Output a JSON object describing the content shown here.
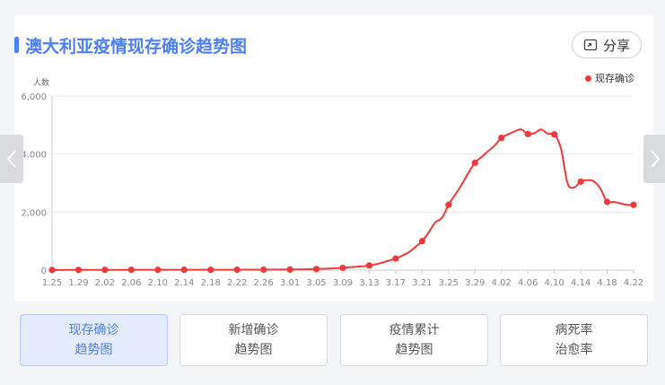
{
  "header": {
    "title": "澳大利亚疫情现存确诊趋势图",
    "share_label": "分享"
  },
  "colors": {
    "accent": "#4d7ff5",
    "series": "#f03a3a",
    "grid": "#ececec",
    "axis_text": "#888888"
  },
  "tabs": [
    {
      "line1": "现存确诊",
      "line2": "趋势图",
      "active": true
    },
    {
      "line1": "新增确诊",
      "line2": "趋势图",
      "active": false
    },
    {
      "line1": "疫情累计",
      "line2": "趋势图",
      "active": false
    },
    {
      "line1": "病死率",
      "line2": "治愈率",
      "active": false
    }
  ],
  "chart_data": {
    "type": "line",
    "title": "澳大利亚疫情现存确诊趋势图",
    "ylabel": "人数",
    "ylim": [
      0,
      6000
    ],
    "yticks": [
      0,
      2000,
      4000,
      6000
    ],
    "ytick_labels": [
      "0",
      "2,000",
      "4,000",
      "6,000"
    ],
    "xtick_labels": [
      "1.25",
      "1.29",
      "2.02",
      "2.06",
      "2.10",
      "2.14",
      "2.18",
      "2.22",
      "2.26",
      "3.01",
      "3.05",
      "3.09",
      "3.13",
      "3.17",
      "3.21",
      "3.25",
      "3.29",
      "4.02",
      "4.06",
      "4.10",
      "4.14",
      "4.18",
      "4.22"
    ],
    "legend_position": "top-right",
    "grid": true,
    "series": [
      {
        "name": "现存确诊",
        "color": "#f03a3a",
        "dates": [
          "1.25",
          "1.26",
          "1.27",
          "1.28",
          "1.29",
          "1.30",
          "1.31",
          "2.01",
          "2.02",
          "2.03",
          "2.04",
          "2.05",
          "2.06",
          "2.07",
          "2.08",
          "2.09",
          "2.10",
          "2.11",
          "2.12",
          "2.13",
          "2.14",
          "2.15",
          "2.16",
          "2.17",
          "2.18",
          "2.19",
          "2.20",
          "2.21",
          "2.22",
          "2.23",
          "2.24",
          "2.25",
          "2.26",
          "2.27",
          "2.28",
          "2.29",
          "3.01",
          "3.02",
          "3.03",
          "3.04",
          "3.05",
          "3.06",
          "3.07",
          "3.08",
          "3.09",
          "3.10",
          "3.11",
          "3.12",
          "3.13",
          "3.14",
          "3.15",
          "3.16",
          "3.17",
          "3.18",
          "3.19",
          "3.20",
          "3.21",
          "3.22",
          "3.23",
          "3.24",
          "3.25",
          "3.26",
          "3.27",
          "3.28",
          "3.29",
          "3.30",
          "3.31",
          "4.01",
          "4.02",
          "4.03",
          "4.04",
          "4.05",
          "4.06",
          "4.07",
          "4.08",
          "4.09",
          "4.10",
          "4.11",
          "4.12",
          "4.13",
          "4.14",
          "4.15",
          "4.16",
          "4.17",
          "4.18",
          "4.19",
          "4.20",
          "4.21",
          "4.22"
        ],
        "values": [
          4,
          4,
          5,
          5,
          6,
          7,
          8,
          8,
          10,
          10,
          10,
          10,
          12,
          12,
          12,
          12,
          12,
          12,
          12,
          12,
          12,
          12,
          12,
          12,
          12,
          12,
          12,
          12,
          15,
          15,
          15,
          15,
          18,
          18,
          20,
          20,
          22,
          25,
          28,
          32,
          38,
          45,
          55,
          65,
          80,
          100,
          115,
          130,
          160,
          200,
          260,
          330,
          400,
          500,
          620,
          800,
          1000,
          1300,
          1650,
          1800,
          2250,
          2600,
          2950,
          3350,
          3700,
          3900,
          4100,
          4300,
          4560,
          4680,
          4780,
          4850,
          4690,
          4720,
          4850,
          4700,
          4680,
          4200,
          3000,
          2850,
          3050,
          3100,
          3060,
          2800,
          2350,
          2350,
          2300,
          2250,
          2250
        ],
        "marked_dates": [
          "1.25",
          "1.29",
          "2.02",
          "2.06",
          "2.10",
          "2.14",
          "2.18",
          "2.22",
          "2.26",
          "3.01",
          "3.05",
          "3.09",
          "3.13",
          "3.17",
          "3.21",
          "3.25",
          "3.29",
          "4.02",
          "4.06",
          "4.10",
          "4.14",
          "4.18",
          "4.22"
        ]
      }
    ]
  }
}
